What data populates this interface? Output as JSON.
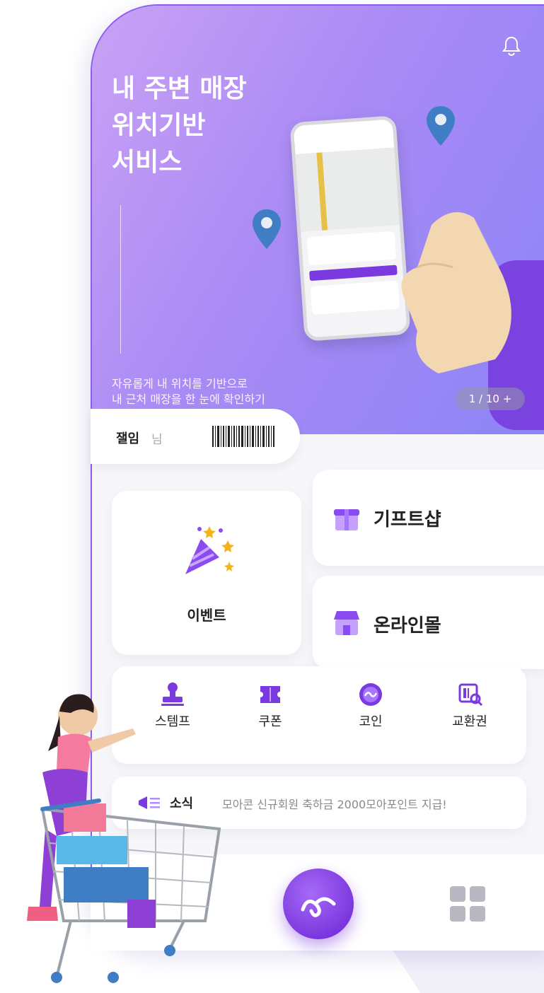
{
  "hero": {
    "title_lines": [
      "내 주변 매장",
      "위치기반",
      "서비스"
    ],
    "description_lines": [
      "자유롭게 내 위치를 기반으로",
      "내 근처 매장을 한 눈에 확인하기"
    ],
    "counter": "1 / 10 +"
  },
  "user": {
    "name": "잴임",
    "suffix": "님"
  },
  "cards": {
    "event": "이벤트",
    "gift": "기프트샵",
    "mall": "온라인몰"
  },
  "menu": {
    "items": [
      {
        "label": "스템프",
        "icon": "stamp-icon"
      },
      {
        "label": "쿠폰",
        "icon": "coupon-icon"
      },
      {
        "label": "코인",
        "icon": "coin-icon"
      },
      {
        "label": "교환권",
        "icon": "voucher-icon"
      }
    ]
  },
  "news": {
    "label": "소식",
    "text": "모아콘 신규회원 축하금 2000모아포인트 지급!"
  },
  "colors": {
    "accent": "#7b3ae0",
    "hero_start": "#c9a1f5",
    "hero_end": "#8b84f7"
  }
}
